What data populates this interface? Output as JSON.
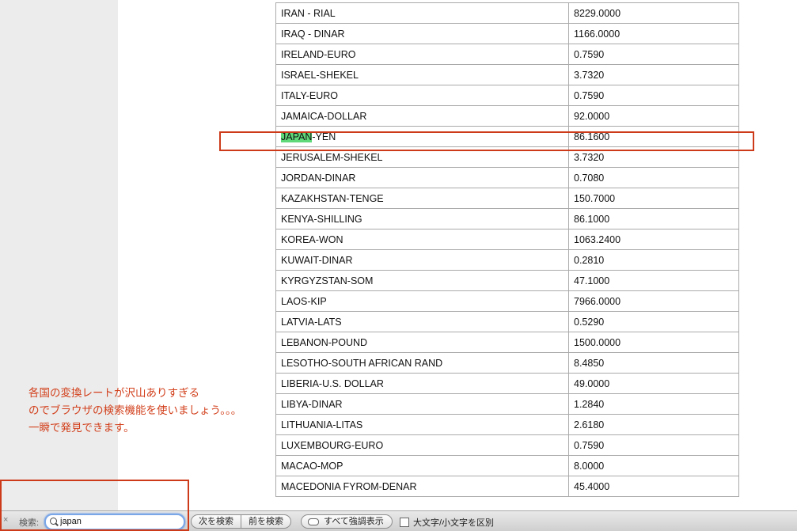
{
  "rates": [
    {
      "name": "IRAN - RIAL",
      "rate": "8229.0000"
    },
    {
      "name": "IRAQ - DINAR",
      "rate": "1166.0000"
    },
    {
      "name": "IRELAND-EURO",
      "rate": "0.7590"
    },
    {
      "name": "ISRAEL-SHEKEL",
      "rate": "3.7320"
    },
    {
      "name": "ITALY-EURO",
      "rate": "0.7590"
    },
    {
      "name": "JAMAICA-DOLLAR",
      "rate": "92.0000"
    },
    {
      "name": "JAPAN-YEN",
      "rate": "86.1600",
      "match": "JAPAN",
      "rest": "-YEN"
    },
    {
      "name": "JERUSALEM-SHEKEL",
      "rate": "3.7320"
    },
    {
      "name": "JORDAN-DINAR",
      "rate": "0.7080"
    },
    {
      "name": "KAZAKHSTAN-TENGE",
      "rate": "150.7000"
    },
    {
      "name": "KENYA-SHILLING",
      "rate": "86.1000"
    },
    {
      "name": "KOREA-WON",
      "rate": "1063.2400"
    },
    {
      "name": "KUWAIT-DINAR",
      "rate": "0.2810"
    },
    {
      "name": "KYRGYZSTAN-SOM",
      "rate": "47.1000"
    },
    {
      "name": "LAOS-KIP",
      "rate": "7966.0000"
    },
    {
      "name": "LATVIA-LATS",
      "rate": "0.5290"
    },
    {
      "name": "LEBANON-POUND",
      "rate": "1500.0000"
    },
    {
      "name": "LESOTHO-SOUTH AFRICAN RAND",
      "rate": "8.4850"
    },
    {
      "name": "LIBERIA-U.S. DOLLAR",
      "rate": "49.0000"
    },
    {
      "name": "LIBYA-DINAR",
      "rate": "1.2840"
    },
    {
      "name": "LITHUANIA-LITAS",
      "rate": "2.6180"
    },
    {
      "name": "LUXEMBOURG-EURO",
      "rate": "0.7590"
    },
    {
      "name": "MACAO-MOP",
      "rate": "8.0000"
    },
    {
      "name": "MACEDONIA FYROM-DENAR",
      "rate": "45.4000"
    }
  ],
  "note": {
    "line1": "各国の変換レートが沢山ありすぎる",
    "line2": "のでブラウザの検索機能を使いましょう。。。",
    "line3": "一瞬で発見できます。"
  },
  "find_bar": {
    "close_symbol": "×",
    "label": "検索:",
    "query": "japan",
    "next_label": "次を検索",
    "prev_label": "前を検索",
    "highlight_all_label": "すべて強調表示",
    "match_case_label": "大文字/小文字を区別"
  },
  "colors": {
    "annotation_red": "#cc3a1a",
    "match_highlight": "#5fd87a",
    "note_text": "#d2401c"
  }
}
